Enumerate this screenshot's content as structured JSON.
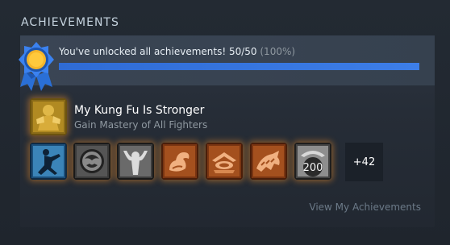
{
  "section": {
    "title": "ACHIEVEMENTS"
  },
  "summary": {
    "text": "You've unlocked all achievements! 50/50",
    "percent_label": "(100%)",
    "progress": 1.0,
    "icon": "ribbon-medal-icon"
  },
  "featured": {
    "title": "My Kung Fu Is Stronger",
    "description": "Gain Mastery of All Fighters",
    "icon": "fighters-mastery-icon"
  },
  "badges": [
    {
      "icon": "ninja-kick-icon"
    },
    {
      "icon": "dragon-emblem-icon"
    },
    {
      "icon": "fighter-pose-icon"
    },
    {
      "icon": "flexed-arm-icon"
    },
    {
      "icon": "crossed-blades-icon"
    },
    {
      "icon": "creature-icon"
    },
    {
      "icon": "number-200-icon",
      "label": "200"
    }
  ],
  "more": {
    "label": "+42"
  },
  "link": {
    "label": "View My Achievements"
  },
  "colors": {
    "accent": "#3d7ee8",
    "badge_glow": "#ff9628",
    "medal_gold": "#f5b52a",
    "ribbon_blue": "#2a6fd6"
  }
}
